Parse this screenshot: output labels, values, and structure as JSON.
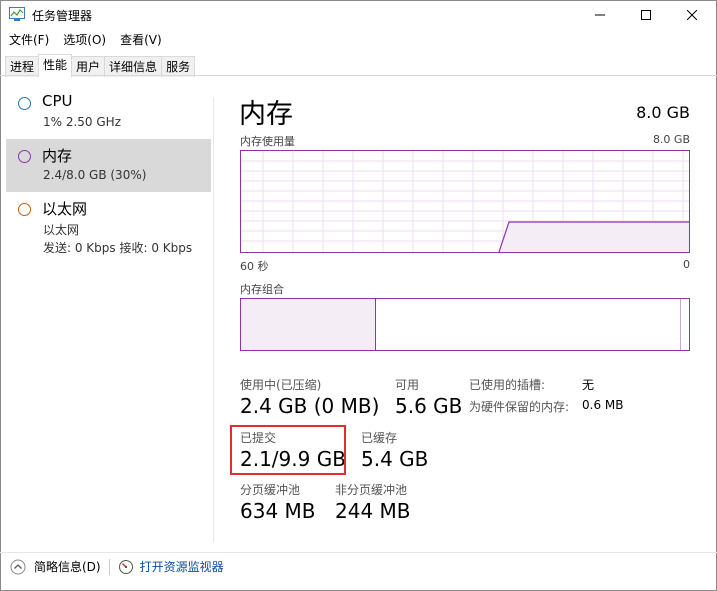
{
  "window": {
    "title": "任务管理器"
  },
  "menu": [
    "文件(F)",
    "选项(O)",
    "查看(V)"
  ],
  "tabs": [
    "进程",
    "性能",
    "用户",
    "详细信息",
    "服务"
  ],
  "sidebar": {
    "items": [
      {
        "title": "CPU",
        "sub": "1% 2.50 GHz",
        "color": "#1f7bbf"
      },
      {
        "title": "内存",
        "sub": "2.4/8.0 GB (30%)",
        "color": "#8b35a7"
      },
      {
        "title": "以太网",
        "sub": "以太网",
        "sub2": "发送: 0 Kbps 接收: 0 Kbps",
        "color": "#c45f15"
      }
    ]
  },
  "main": {
    "title": "内存",
    "total": "8.0 GB",
    "usage_label": "内存使用量",
    "usage_max": "8.0 GB",
    "time_left": "60 秒",
    "time_right": "0",
    "composition_label": "内存组合",
    "usage_fraction": 0.3
  },
  "stats": {
    "in_use_label": "使用中(已压缩)",
    "in_use_value": "2.4 GB (0 MB)",
    "available_label": "可用",
    "available_value": "5.6 GB",
    "slots_label": "已使用的插槽:",
    "slots_value": "无",
    "reserved_label": "为硬件保留的内存:",
    "reserved_value": "0.6 MB",
    "committed_label": "已提交",
    "committed_value": "2.1/9.9 GB",
    "cached_label": "已缓存",
    "cached_value": "5.4 GB",
    "paged_label": "分页缓冲池",
    "paged_value": "634 MB",
    "nonpaged_label": "非分页缓冲池",
    "nonpaged_value": "244 MB"
  },
  "footer": {
    "summary_label": "简略信息(D)",
    "monitor_link": "打开资源监视器"
  },
  "colors": {
    "accent": "#8b35a7",
    "highlight": "#e0302b",
    "link": "#0a4fa3"
  }
}
